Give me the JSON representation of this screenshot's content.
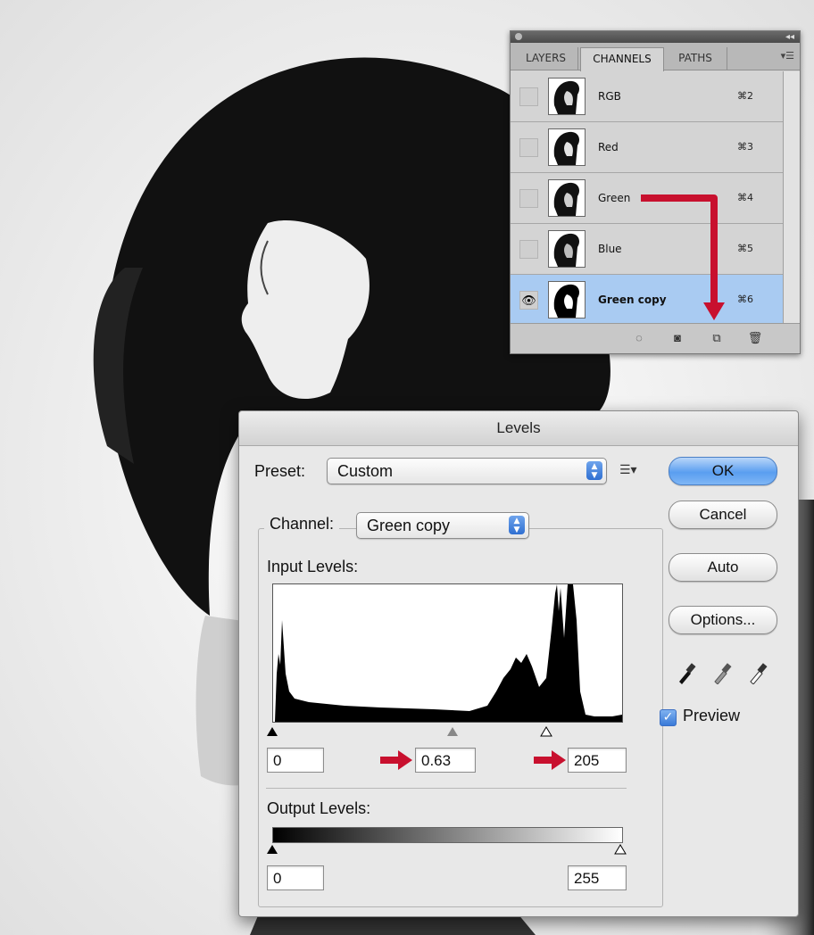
{
  "channels_panel": {
    "tabs": [
      "LAYERS",
      "CHANNELS",
      "PATHS"
    ],
    "active_tab": "CHANNELS",
    "rows": [
      {
        "name": "RGB",
        "shortcut": "⌘2",
        "visible": false,
        "selected": false
      },
      {
        "name": "Red",
        "shortcut": "⌘3",
        "visible": false,
        "selected": false
      },
      {
        "name": "Green",
        "shortcut": "⌘4",
        "visible": false,
        "selected": false
      },
      {
        "name": "Blue",
        "shortcut": "⌘5",
        "visible": false,
        "selected": false
      },
      {
        "name": "Green copy",
        "shortcut": "⌘6",
        "visible": true,
        "selected": true
      }
    ],
    "footer_icons": [
      "load-selection-icon",
      "save-selection-icon",
      "new-channel-icon",
      "delete-channel-icon"
    ],
    "annotation_color": "#c8102e"
  },
  "levels_dialog": {
    "title": "Levels",
    "preset_label": "Preset:",
    "preset_value": "Custom",
    "channel_label": "Channel:",
    "channel_value": "Green copy",
    "input_levels_label": "Input Levels:",
    "input_black": "0",
    "input_gamma": "0.63",
    "input_white": "205",
    "input_black_fraction": 0.0,
    "input_gamma_fraction": 0.53,
    "input_white_fraction": 0.8,
    "output_levels_label": "Output Levels:",
    "output_black": "0",
    "output_white": "255",
    "buttons": {
      "ok": "OK",
      "cancel": "Cancel",
      "auto": "Auto",
      "options": "Options..."
    },
    "preview_label": "Preview",
    "preview_checked": true,
    "accent_color": "#3a7ad8",
    "arrow_color": "#c8102e"
  }
}
